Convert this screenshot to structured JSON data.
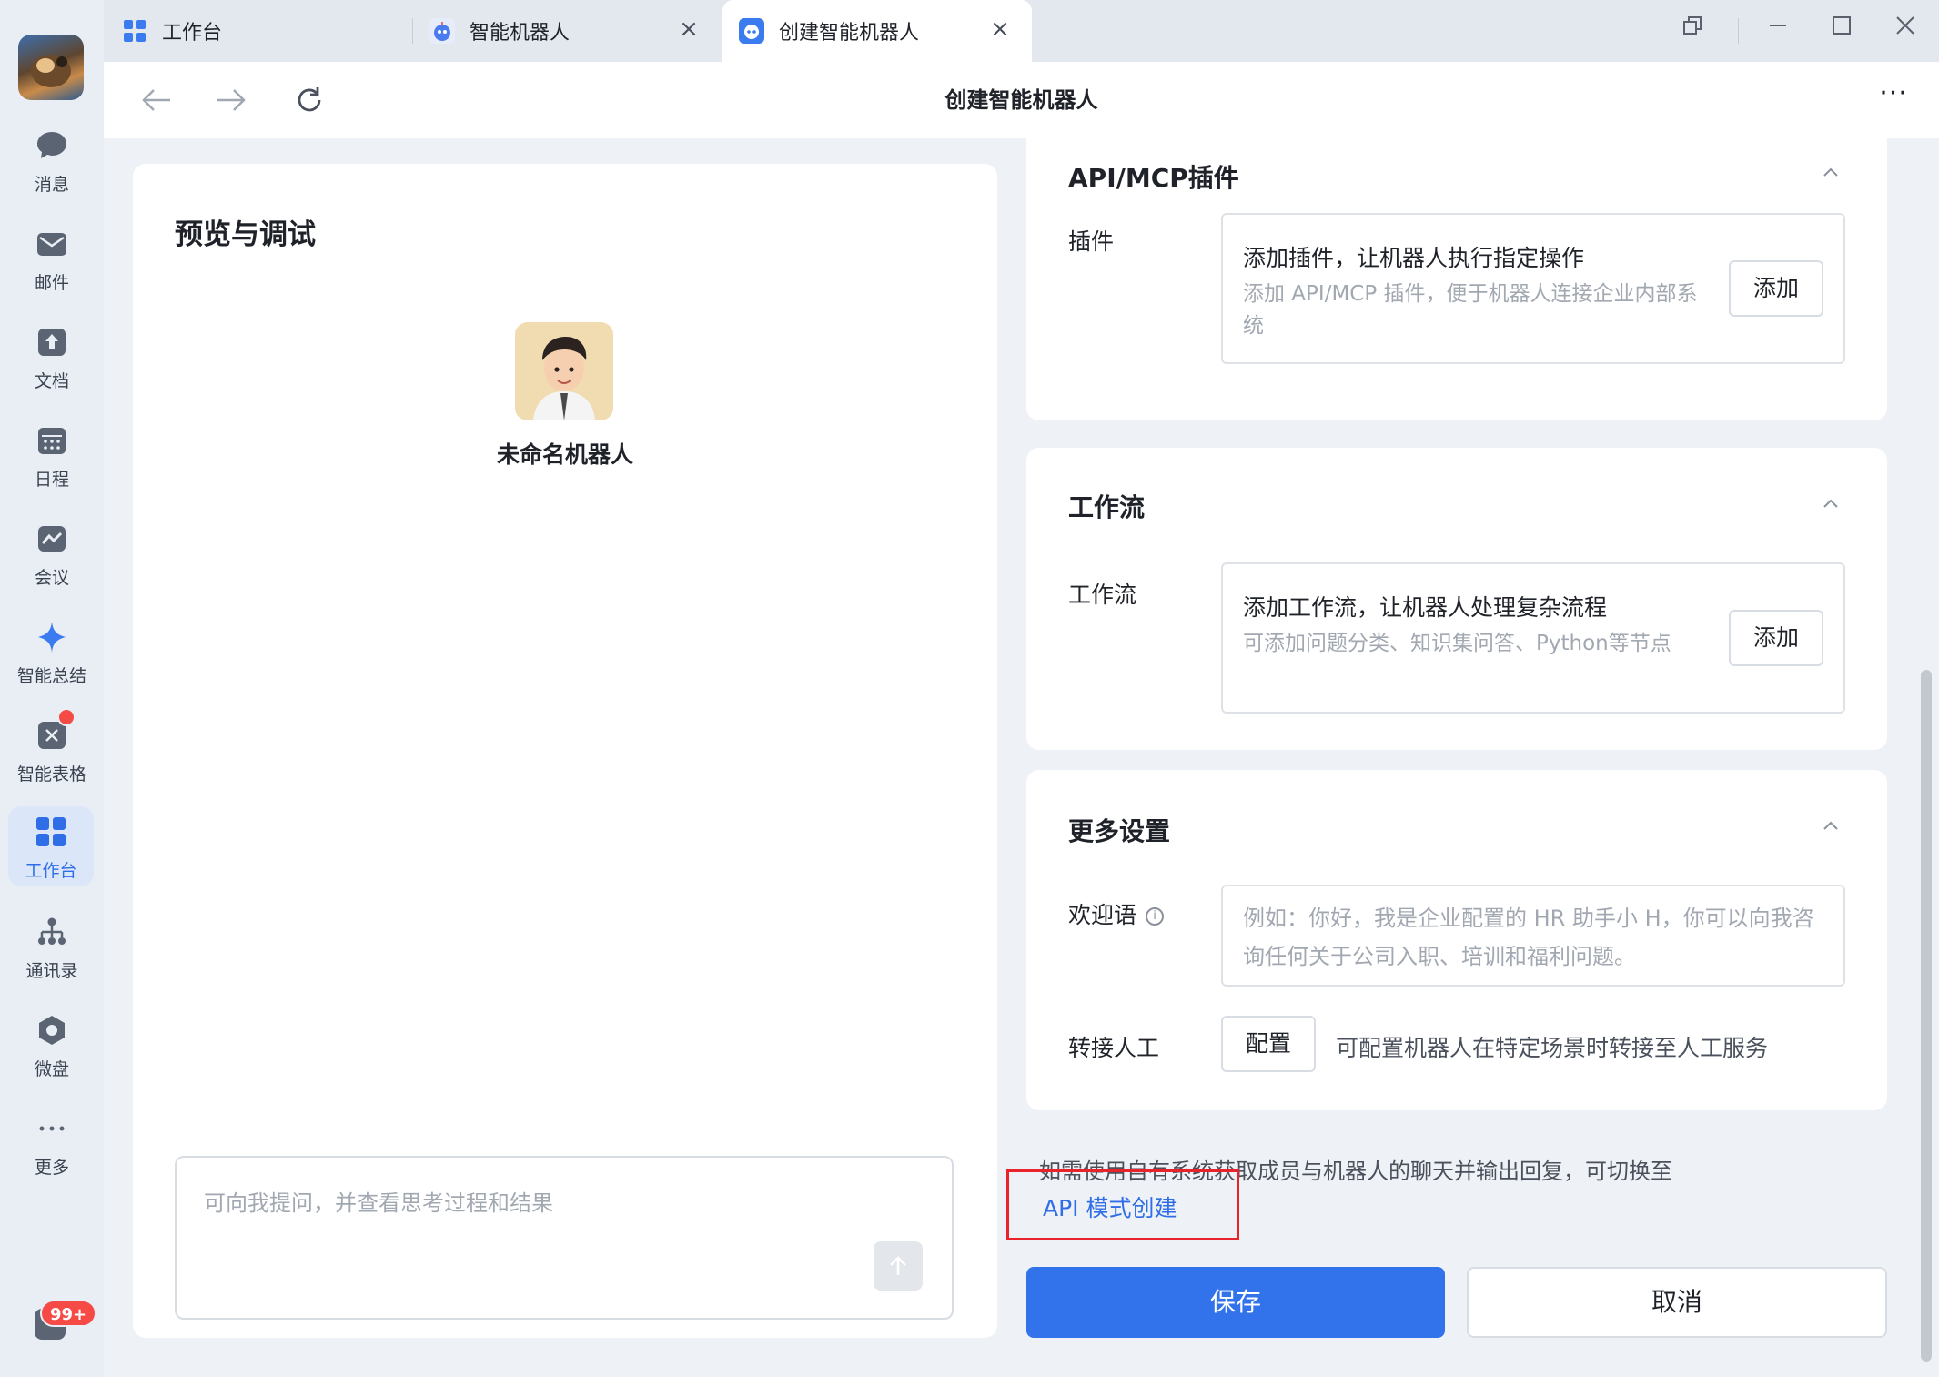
{
  "sidebar": {
    "items": [
      {
        "label": "消息",
        "icon": "chat-bubble-icon"
      },
      {
        "label": "邮件",
        "icon": "mail-icon"
      },
      {
        "label": "文档",
        "icon": "docs-icon"
      },
      {
        "label": "日程",
        "icon": "calendar-icon"
      },
      {
        "label": "会议",
        "icon": "meeting-icon"
      },
      {
        "label": "智能总结",
        "icon": "sparkle-icon"
      },
      {
        "label": "智能表格",
        "icon": "smart-sheet-icon"
      },
      {
        "label": "工作台",
        "icon": "workbench-icon"
      },
      {
        "label": "通讯录",
        "icon": "contacts-icon"
      },
      {
        "label": "微盘",
        "icon": "drive-icon"
      },
      {
        "label": "更多",
        "icon": "more-dots-icon"
      }
    ],
    "active_index": 7,
    "badge": "99+"
  },
  "tabs": [
    {
      "label": "工作台",
      "icon": "workbench-icon"
    },
    {
      "label": "智能机器人",
      "icon": "robot-icon"
    },
    {
      "label": "创建智能机器人",
      "icon": "robot-icon"
    }
  ],
  "nav": {
    "title": "创建智能机器人",
    "more": "···"
  },
  "preview": {
    "title": "预览与调试",
    "bot_name": "未命名机器人",
    "input_placeholder": "可向我提问，并查看思考过程和结果"
  },
  "plugins": {
    "title": "API/MCP插件",
    "row_label": "插件",
    "heading": "添加插件，让机器人执行指定操作",
    "sub": "添加 API/MCP 插件，便于机器人连接企业内部系统",
    "button": "添加"
  },
  "workflow": {
    "title": "工作流",
    "row_label": "工作流",
    "heading": "添加工作流，让机器人处理复杂流程",
    "sub": "可添加问题分类、知识集问答、Python等节点",
    "button": "添加"
  },
  "more_settings": {
    "title": "更多设置",
    "welcome_label": "欢迎语",
    "welcome_placeholder": "例如：你好，我是企业配置的 HR 助手小 H，你可以向我咨询任何关于公司入职、培训和福利问题。",
    "transfer_label": "转接人工",
    "transfer_button": "配置",
    "transfer_desc": "可配置机器人在特定场景时转接至人工服务"
  },
  "footer": {
    "hint": "如需使用自有系统获取成员与机器人的聊天并输出回复，可切换至",
    "api_link": "API 模式创建",
    "save": "保存",
    "cancel": "取消"
  },
  "colors": {
    "accent": "#3272ea",
    "highlight": "#e8232c",
    "badge": "#f54a45"
  }
}
